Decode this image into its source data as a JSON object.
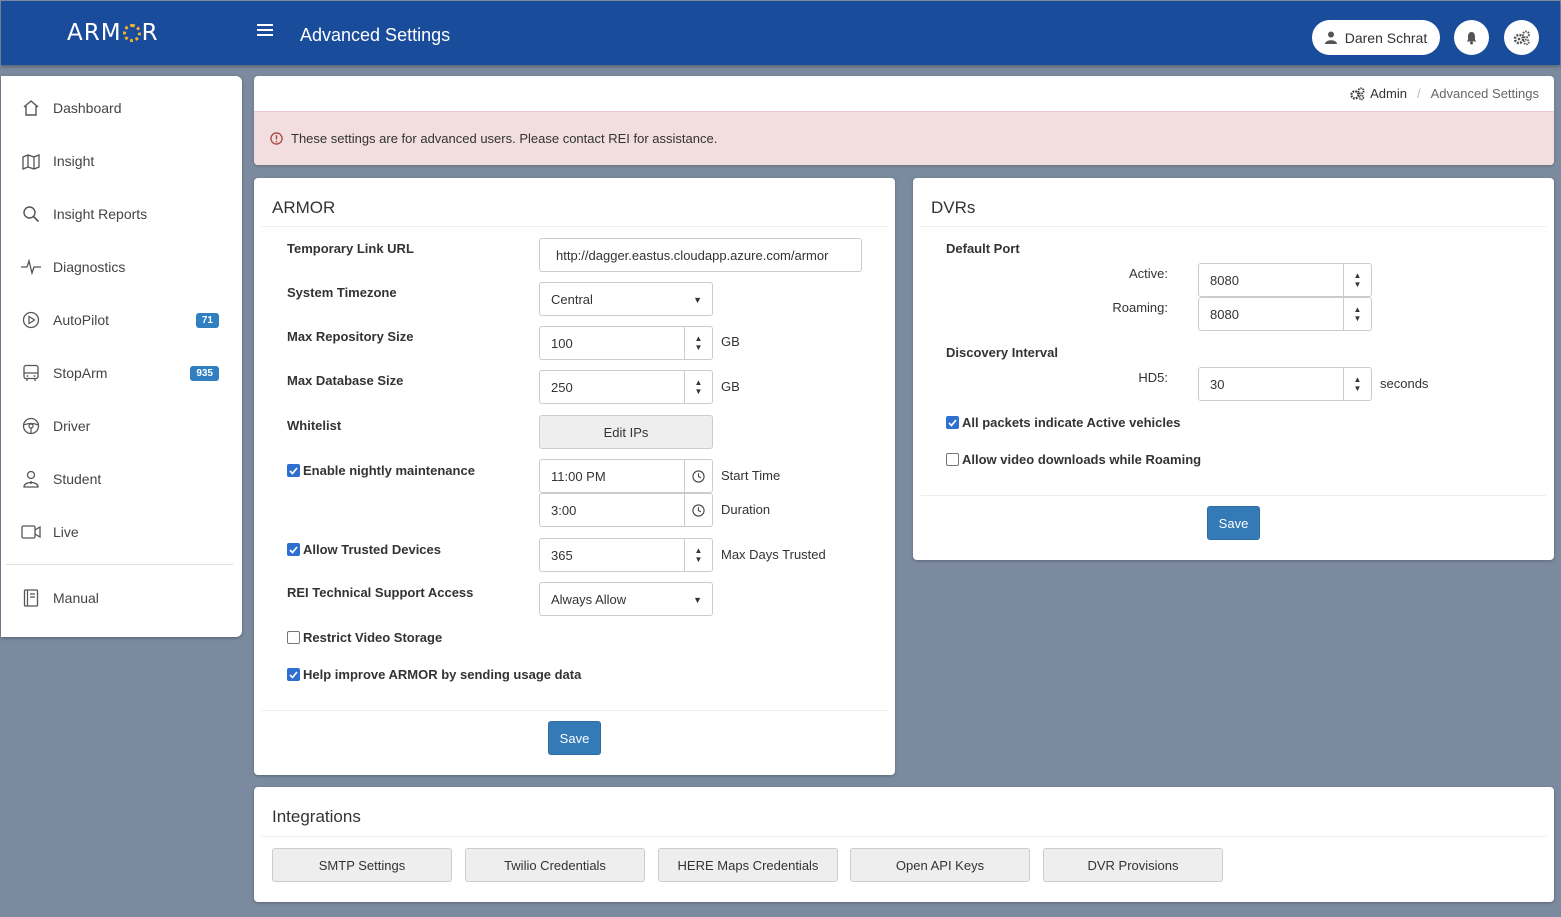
{
  "header": {
    "logo_left": "ARM",
    "logo_right": "R",
    "title": "Advanced Settings",
    "user_name": "Daren Schrat",
    "icons": {
      "menu": "hamburger-icon",
      "user": "user-icon",
      "notifications": "bell-icon",
      "settings": "gears-icon"
    }
  },
  "sidebar": {
    "items": [
      {
        "label": "Dashboard",
        "icon": "home-icon"
      },
      {
        "label": "Insight",
        "icon": "map-icon"
      },
      {
        "label": "Insight Reports",
        "icon": "search-icon"
      },
      {
        "label": "Diagnostics",
        "icon": "pulse-icon"
      },
      {
        "label": "AutoPilot",
        "icon": "play-circle-icon",
        "badge": "71"
      },
      {
        "label": "StopArm",
        "icon": "bus-icon",
        "badge": "935"
      },
      {
        "label": "Driver",
        "icon": "steering-wheel-icon"
      },
      {
        "label": "Student",
        "icon": "student-icon"
      },
      {
        "label": "Live",
        "icon": "video-camera-icon"
      },
      {
        "label": "Manual",
        "icon": "book-icon"
      }
    ]
  },
  "breadcrumb": {
    "admin": "Admin",
    "current": "Advanced Settings"
  },
  "alert": {
    "text": "These settings are for advanced users. Please contact REI for assistance."
  },
  "armor": {
    "title": "ARMOR",
    "temp_link_label": "Temporary Link URL",
    "temp_link_value": "http://dagger.eastus.cloudapp.azure.com/armor",
    "timezone_label": "System Timezone",
    "timezone_value": "Central",
    "max_repo_label": "Max Repository Size",
    "max_repo_value": "100",
    "max_repo_unit": "GB",
    "max_db_label": "Max Database Size",
    "max_db_value": "250",
    "max_db_unit": "GB",
    "whitelist_label": "Whitelist",
    "whitelist_button": "Edit IPs",
    "nightly_label": "Enable nightly maintenance",
    "nightly_checked": true,
    "start_time_value": "11:00 PM",
    "start_time_label": "Start Time",
    "duration_value": "3:00",
    "duration_label": "Duration",
    "trusted_label": "Allow Trusted Devices",
    "trusted_checked": true,
    "trusted_days_value": "365",
    "trusted_days_label": "Max Days Trusted",
    "support_label": "REI Technical Support Access",
    "support_value": "Always Allow",
    "restrict_label": "Restrict Video Storage",
    "restrict_checked": false,
    "usage_label": "Help improve ARMOR by sending usage data",
    "usage_checked": true,
    "save": "Save"
  },
  "dvrs": {
    "title": "DVRs",
    "default_port_label": "Default Port",
    "active_label": "Active:",
    "active_value": "8080",
    "roaming_label": "Roaming:",
    "roaming_value": "8080",
    "discovery_label": "Discovery Interval",
    "hd5_label": "HD5:",
    "hd5_value": "30",
    "hd5_unit": "seconds",
    "all_packets_label": "All packets indicate Active vehicles",
    "all_packets_checked": true,
    "video_roaming_label": "Allow video downloads while Roaming",
    "video_roaming_checked": false,
    "save": "Save"
  },
  "integrations": {
    "title": "Integrations",
    "buttons": [
      "SMTP Settings",
      "Twilio Credentials",
      "HERE Maps Credentials",
      "Open API Keys",
      "DVR Provisions"
    ]
  }
}
